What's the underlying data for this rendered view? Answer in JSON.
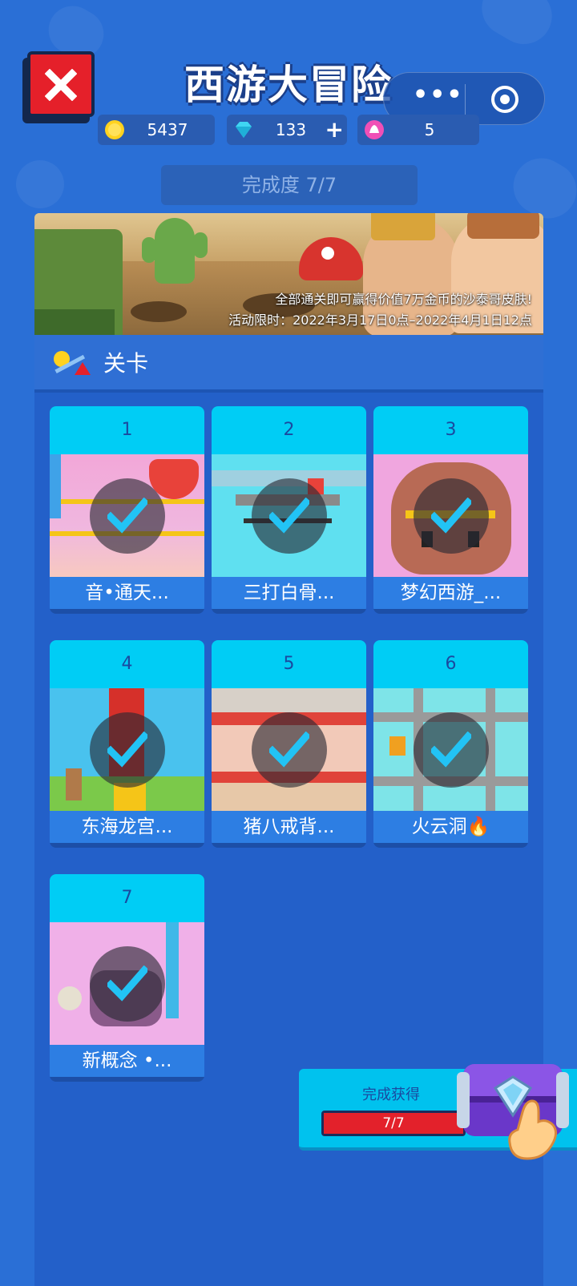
{
  "header": {
    "title": "西游大冒险",
    "capsule_dots": "•••"
  },
  "resources": [
    {
      "icon": "gold-coin-icon",
      "value": "5437",
      "has_plus": false
    },
    {
      "icon": "diamond-icon",
      "value": "133",
      "has_plus": true,
      "plus_label": "+"
    },
    {
      "icon": "energy-icon",
      "value": "5",
      "has_plus": false
    }
  ],
  "progress_label": "完成度 7/7",
  "banner": {
    "line1": "全部通关即可赢得价值7万金币的沙泰哥皮肤!",
    "line2": "活动限时：2022年3月17日0点–2022年4月1日12点"
  },
  "levels_panel": {
    "title": "关卡",
    "levels": [
      {
        "number": "1",
        "name": "音•通天...",
        "completed": true
      },
      {
        "number": "2",
        "name": "三打白骨...",
        "completed": true
      },
      {
        "number": "3",
        "name": "梦幻西游_...",
        "completed": true
      },
      {
        "number": "4",
        "name": "东海龙宫...",
        "completed": true
      },
      {
        "number": "5",
        "name": "猪八戒背...",
        "completed": true
      },
      {
        "number": "6",
        "name": "火云洞🔥",
        "completed": true
      },
      {
        "number": "7",
        "name": "新概念 •...",
        "completed": true
      }
    ]
  },
  "reward": {
    "label": "完成获得",
    "progress_text": "7/7",
    "progress_fraction": 1.0
  },
  "colors": {
    "background": "#2a6fd6",
    "level_header": "#00cdf5",
    "close_button": "#e5202a",
    "reward_bar": "#e3212b"
  }
}
